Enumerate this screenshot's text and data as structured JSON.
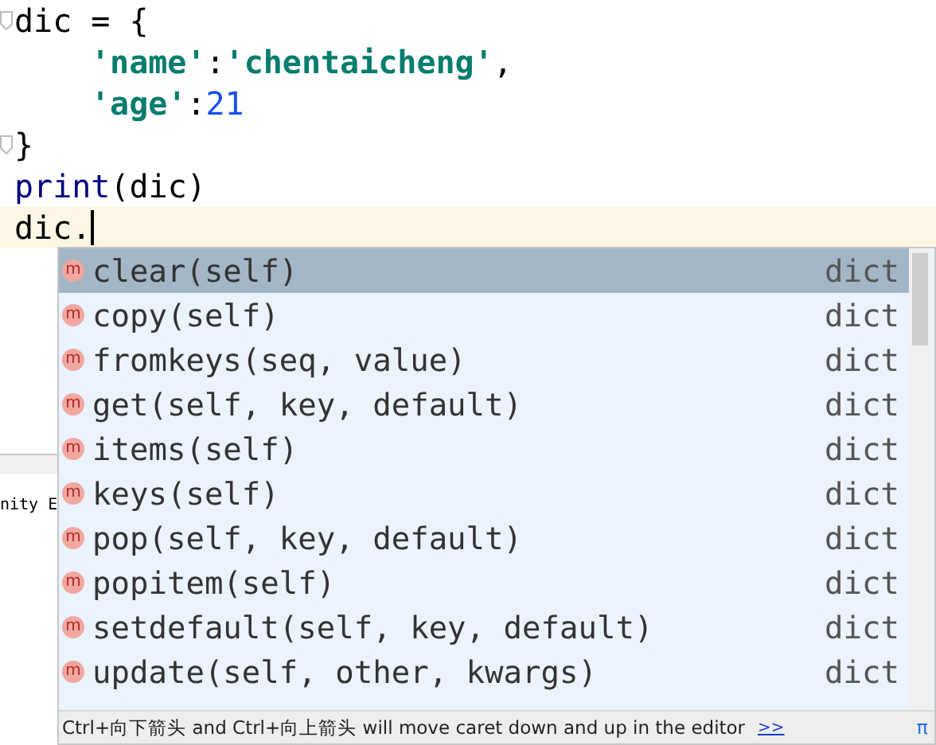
{
  "editor": {
    "lines": [
      {
        "indented": false,
        "tokens": [
          {
            "kind": "plain",
            "text": "dic = {"
          }
        ],
        "current": false,
        "fold": true
      },
      {
        "indented": true,
        "tokens": [
          {
            "kind": "string",
            "text": "'name'"
          },
          {
            "kind": "plain",
            "text": ":"
          },
          {
            "kind": "string",
            "text": "'chentaicheng'"
          },
          {
            "kind": "plain",
            "text": ","
          }
        ],
        "current": false,
        "fold": false
      },
      {
        "indented": true,
        "tokens": [
          {
            "kind": "string",
            "text": "'age'"
          },
          {
            "kind": "plain",
            "text": ":"
          },
          {
            "kind": "number",
            "text": "21"
          }
        ],
        "current": false,
        "fold": false
      },
      {
        "indented": false,
        "tokens": [
          {
            "kind": "plain",
            "text": "}"
          }
        ],
        "current": false,
        "fold": true
      },
      {
        "indented": false,
        "tokens": [
          {
            "kind": "builtin",
            "text": "print"
          },
          {
            "kind": "plain",
            "text": "(dic)"
          }
        ],
        "current": false,
        "fold": false
      },
      {
        "indented": false,
        "tokens": [
          {
            "kind": "plain",
            "text": "dic."
          }
        ],
        "current": true,
        "fold": false
      }
    ]
  },
  "background_panel": {
    "text": "nity E"
  },
  "completion": {
    "items": [
      {
        "icon": "m",
        "name": "clear(self)",
        "type": "dict",
        "selected": true
      },
      {
        "icon": "m",
        "name": "copy(self)",
        "type": "dict",
        "selected": false
      },
      {
        "icon": "m",
        "name": "fromkeys(seq, value)",
        "type": "dict",
        "selected": false
      },
      {
        "icon": "m",
        "name": "get(self, key, default)",
        "type": "dict",
        "selected": false
      },
      {
        "icon": "m",
        "name": "items(self)",
        "type": "dict",
        "selected": false
      },
      {
        "icon": "m",
        "name": "keys(self)",
        "type": "dict",
        "selected": false
      },
      {
        "icon": "m",
        "name": "pop(self, key, default)",
        "type": "dict",
        "selected": false
      },
      {
        "icon": "m",
        "name": "popitem(self)",
        "type": "dict",
        "selected": false
      },
      {
        "icon": "m",
        "name": "setdefault(self, key, default)",
        "type": "dict",
        "selected": false
      },
      {
        "icon": "m",
        "name": "update(self, other, kwargs)",
        "type": "dict",
        "selected": false
      }
    ],
    "hint": "Ctrl+向下箭头 and Ctrl+向上箭头 will move caret down and up in the editor",
    "hint_link": ">>",
    "pi": "π"
  }
}
